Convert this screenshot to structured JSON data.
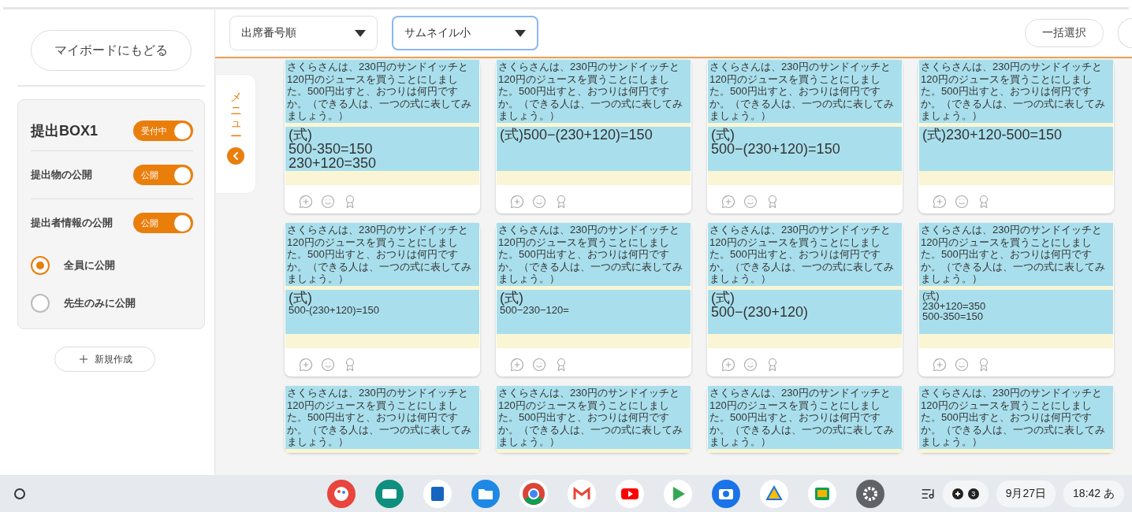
{
  "sidebar": {
    "back_button": "マイボードにもどる",
    "box": {
      "title": "提出BOX1",
      "title_toggle": {
        "label": "受付中",
        "on": true
      },
      "settings": [
        {
          "label": "提出物の公開",
          "toggle": {
            "label": "公開",
            "on": true
          }
        },
        {
          "label": "提出者情報の公開",
          "toggle": {
            "label": "公開",
            "on": true
          }
        }
      ],
      "visibility": [
        {
          "label": "全員に公開",
          "selected": true
        },
        {
          "label": "先生のみに公開",
          "selected": false
        }
      ]
    },
    "new_button": "新規作成"
  },
  "toolbar": {
    "dropdowns": [
      {
        "value": "出席番号順",
        "focused": false
      },
      {
        "value": "サムネイル小",
        "focused": true
      }
    ],
    "select_all": "一括選択"
  },
  "menu_tab": {
    "label": "メニュー"
  },
  "cards": [
    {
      "problem": "さくらさんは、230円のサンドイッチと120円のジュースを買うことにしました。500円出すと、おつりは何円ですか。（できる人は、一つの式に表してみましょう。）",
      "answer": [
        {
          "text": "(式)",
          "kind": "main"
        },
        {
          "text": "500-350=150",
          "kind": "main"
        },
        {
          "text": "230+120=350",
          "kind": "main"
        }
      ]
    },
    {
      "problem": "さくらさんは、230円のサンドイッチと120円のジュースを買うことにしました。500円出すと、おつりは何円ですか。（できる人は、一つの式に表してみましょう。）",
      "answer": [
        {
          "text": "(式)500−(230+120)=150",
          "kind": "main"
        }
      ]
    },
    {
      "problem": "さくらさんは、230円のサンドイッチと120円のジュースを買うことにしました。500円出すと、おつりは何円ですか。（できる人は、一つの式に表してみましょう。）",
      "answer": [
        {
          "text": "(式)",
          "kind": "main"
        },
        {
          "text": "500−(230+120)=150",
          "kind": "main"
        }
      ]
    },
    {
      "problem": "さくらさんは、230円のサンドイッチと120円のジュースを買うことにしました。500円出すと、おつりは何円ですか。（できる人は、一つの式に表してみましょう。）",
      "answer": [
        {
          "text": "(式)230+120-500=150",
          "kind": "main"
        }
      ]
    },
    {
      "problem": "さくらさんは、230円のサンドイッチと120円のジュースを買うことにしました。500円出すと、おつりは何円ですか。（できる人は、一つの式に表してみましょう。）",
      "answer": [
        {
          "text": "(式)",
          "kind": "main"
        },
        {
          "text": "500-(230+120)=150",
          "kind": "sub"
        }
      ]
    },
    {
      "problem": "さくらさんは、230円のサンドイッチと120円のジュースを買うことにしました。500円出すと、おつりは何円ですか。（できる人は、一つの式に表してみましょう。）",
      "answer": [
        {
          "text": "(式)",
          "kind": "main"
        },
        {
          "text": "500−230−120=",
          "kind": "sub"
        }
      ]
    },
    {
      "problem": "さくらさんは、230円のサンドイッチと120円のジュースを買うことにしました。500円出すと、おつりは何円ですか。（できる人は、一つの式に表してみましょう。）",
      "answer": [
        {
          "text": "(式)",
          "kind": "main"
        },
        {
          "text": "500−(230+120)",
          "kind": "main"
        }
      ]
    },
    {
      "problem": "さくらさんは、230円のサンドイッチと120円のジュースを買うことにしました。500円出すと、おつりは何円ですか。（できる人は、一つの式に表してみましょう。）",
      "answer": [
        {
          "text": "(式)",
          "kind": "sub"
        },
        {
          "text": "230+120=350",
          "kind": "sub"
        },
        {
          "text": "500-350=150",
          "kind": "sub"
        }
      ]
    },
    {
      "problem": "さくらさんは、230円のサンドイッチと120円のジュースを買うことにしました。500円出すと、おつりは何円ですか。（できる人は、一つの式に表してみましょう。）"
    },
    {
      "problem": "さくらさんは、230円のサンドイッチと120円のジュースを買うことにしました。500円出すと、おつりは何円ですか。（できる人は、一つの式に表してみましょう。）"
    },
    {
      "problem": "さくらさんは、230円のサンドイッチと120円のジュースを買うことにしました。500円出すと、おつりは何円ですか。（できる人は、一つの式に表してみましょう。）"
    },
    {
      "problem": "さくらさんは、230円のサンドイッチと120円のジュースを買うことにしました。500円出すと、おつりは何円ですか。（できる人は、一つの式に表してみましょう。）"
    }
  ],
  "taskbar": {
    "notification_count": "3",
    "date": "9月27日",
    "time": "18:42",
    "ime": "あ"
  }
}
